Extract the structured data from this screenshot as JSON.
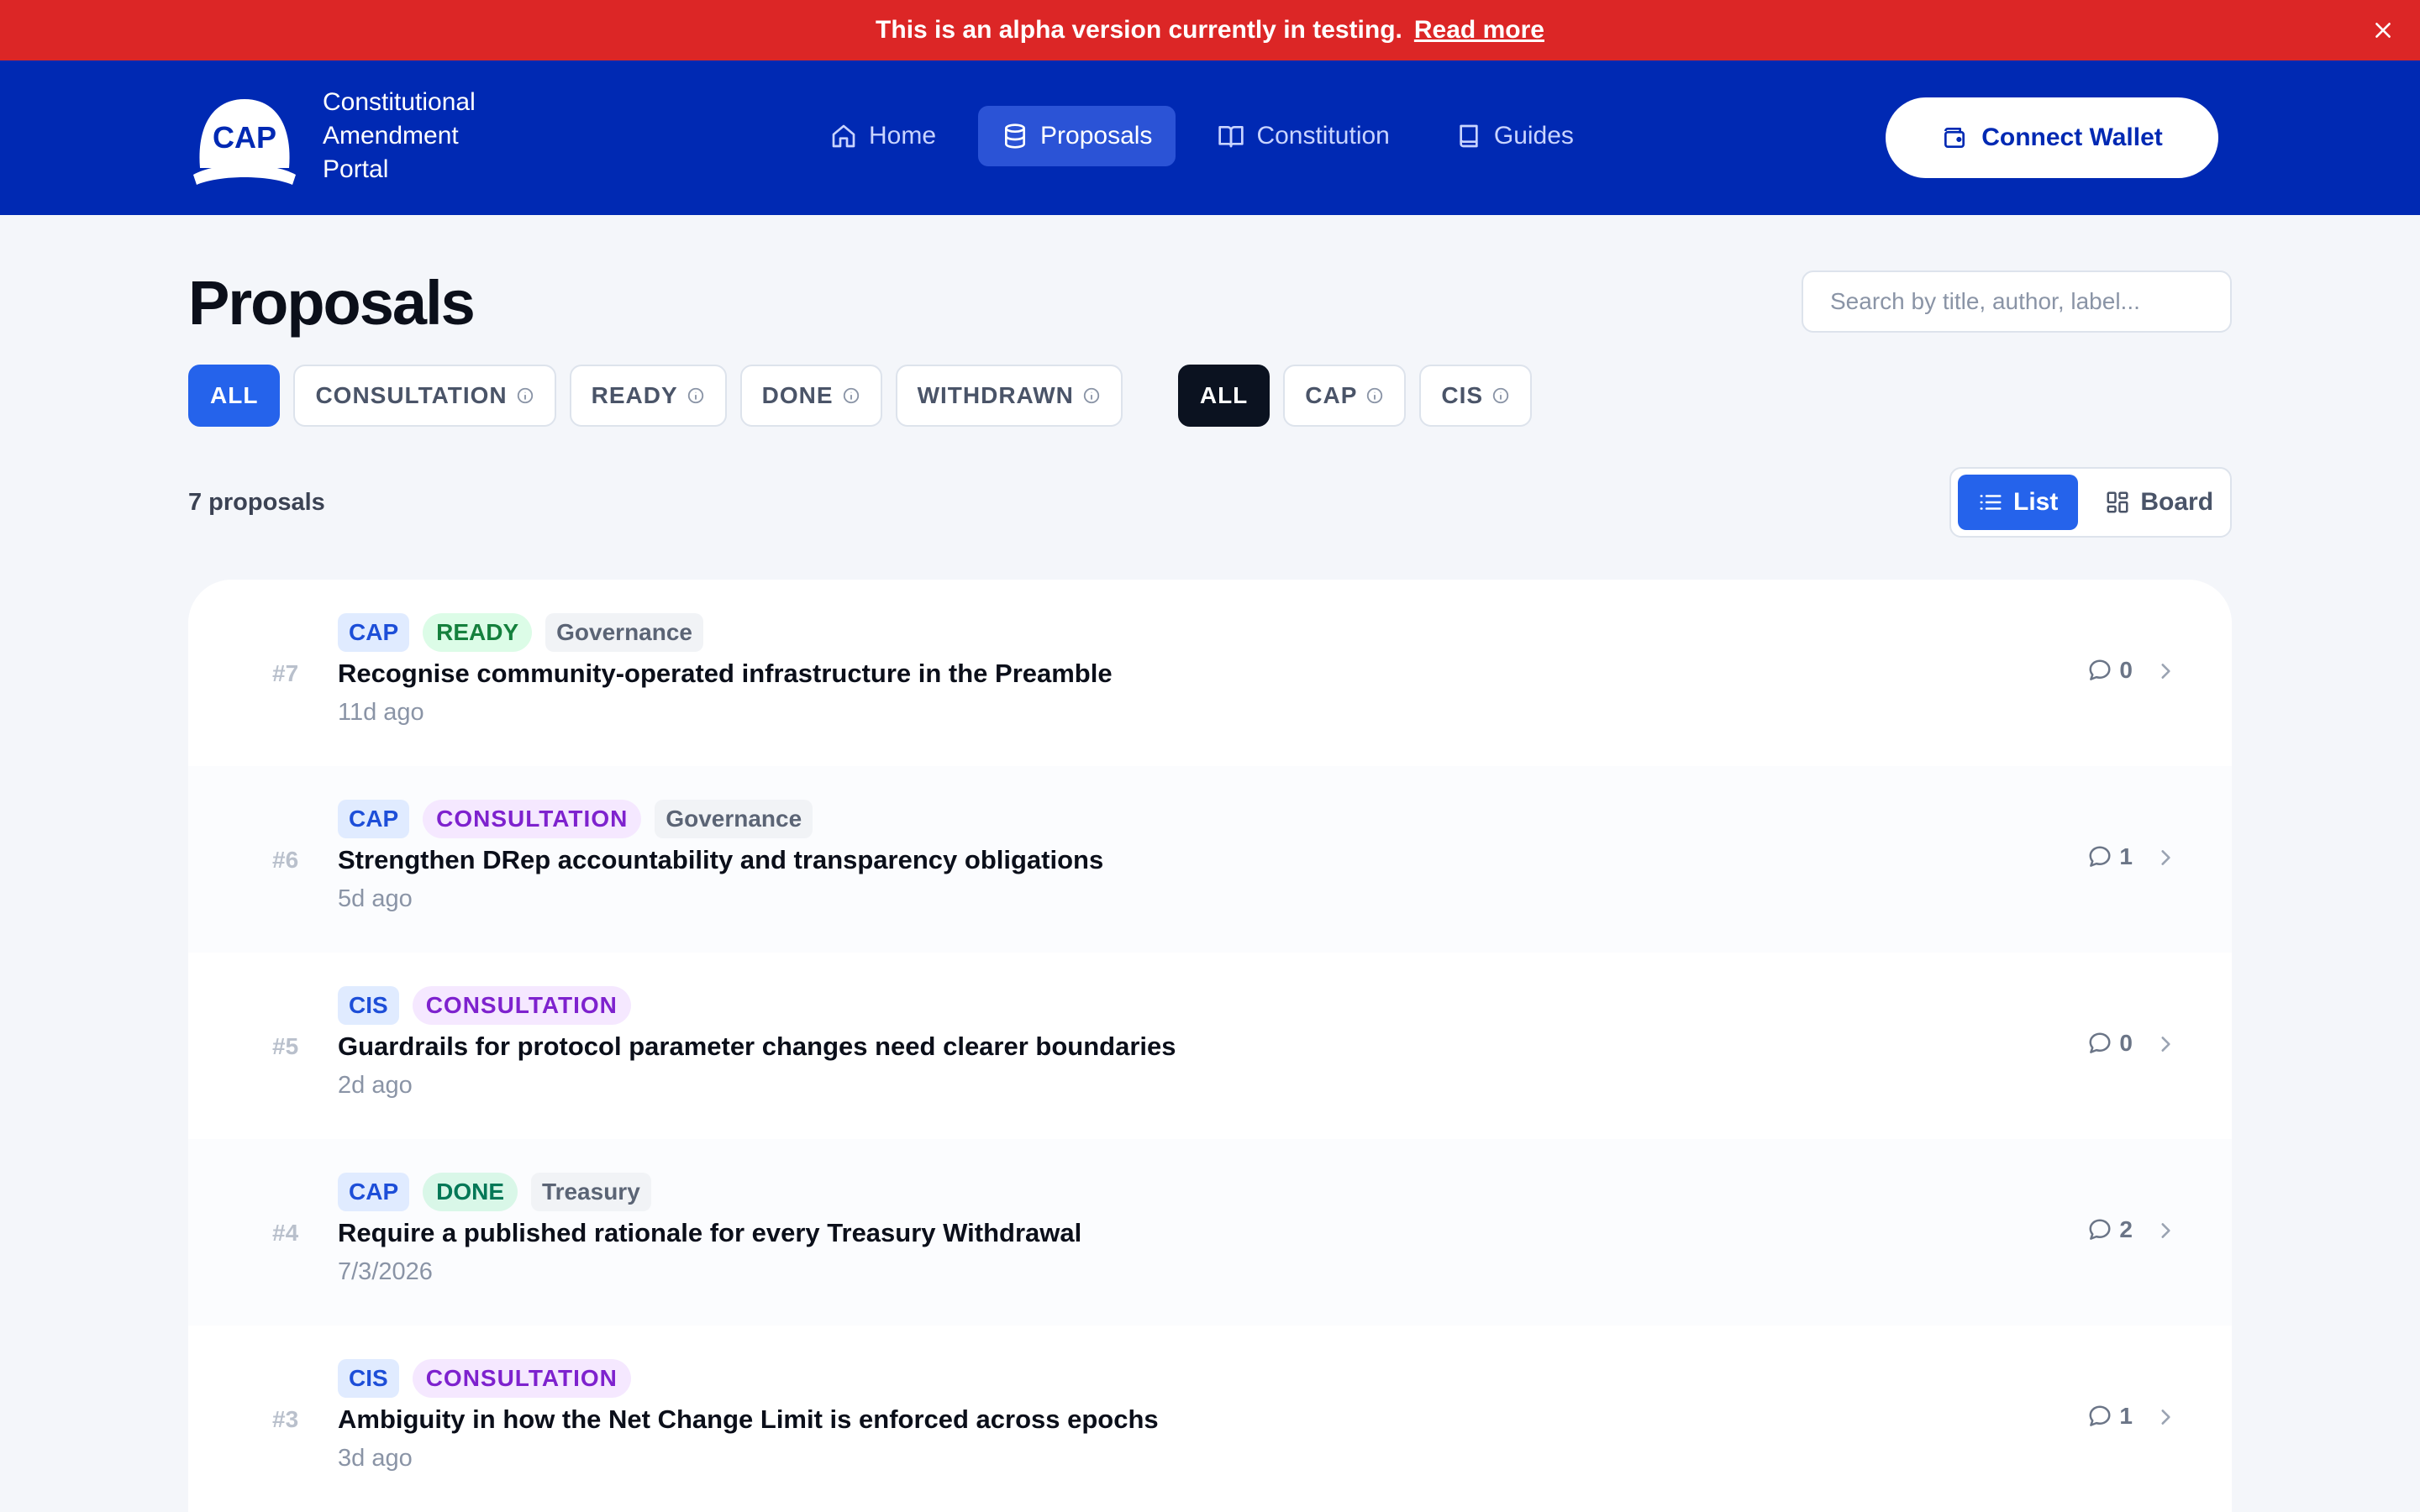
{
  "banner": {
    "message": "This is an alpha version currently in testing.",
    "link": "Read more"
  },
  "brand": {
    "logo_text": "CAP",
    "line1": "Constitutional",
    "line2": "Amendment",
    "line3": "Portal"
  },
  "nav": {
    "items": [
      {
        "label": "Home",
        "icon": "home-icon"
      },
      {
        "label": "Proposals",
        "icon": "database-icon",
        "active": true
      },
      {
        "label": "Constitution",
        "icon": "book-open-icon"
      },
      {
        "label": "Guides",
        "icon": "book-icon"
      }
    ]
  },
  "header": {
    "connect_label": "Connect Wallet"
  },
  "page": {
    "title": "Proposals",
    "search_placeholder": "Search by title, author, label..."
  },
  "filters": {
    "status": [
      {
        "label": "ALL",
        "active": true
      },
      {
        "label": "CONSULTATION"
      },
      {
        "label": "READY"
      },
      {
        "label": "DONE"
      },
      {
        "label": "WITHDRAWN"
      }
    ],
    "type": [
      {
        "label": "ALL",
        "active": true
      },
      {
        "label": "CAP"
      },
      {
        "label": "CIS"
      }
    ]
  },
  "summary": {
    "count": "7 proposals"
  },
  "view": {
    "list": "List",
    "board": "Board"
  },
  "proposals": [
    {
      "num": "#7",
      "type": "CAP",
      "status": "READY",
      "label": "Governance",
      "title": "Recognise community-operated infrastructure in the Preamble",
      "time": "11d ago",
      "comments": "0"
    },
    {
      "num": "#6",
      "type": "CAP",
      "status": "CONSULTATION",
      "label": "Governance",
      "title": "Strengthen DRep accountability and transparency obligations",
      "time": "5d ago",
      "comments": "1"
    },
    {
      "num": "#5",
      "type": "CIS",
      "status": "CONSULTATION",
      "label": "",
      "title": "Guardrails for protocol parameter changes need clearer boundaries",
      "time": "2d ago",
      "comments": "0"
    },
    {
      "num": "#4",
      "type": "CAP",
      "status": "DONE",
      "label": "Treasury",
      "title": "Require a published rationale for every Treasury Withdrawal",
      "time": "7/3/2026",
      "comments": "2"
    },
    {
      "num": "#3",
      "type": "CIS",
      "status": "CONSULTATION",
      "label": "",
      "title": "Ambiguity in how the Net Change Limit is enforced across epochs",
      "time": "3d ago",
      "comments": "1"
    }
  ],
  "colors": {
    "banner": "#dc2626",
    "header": "#0029b3",
    "accent": "#2563eb",
    "dark_chip": "#0b1220"
  }
}
